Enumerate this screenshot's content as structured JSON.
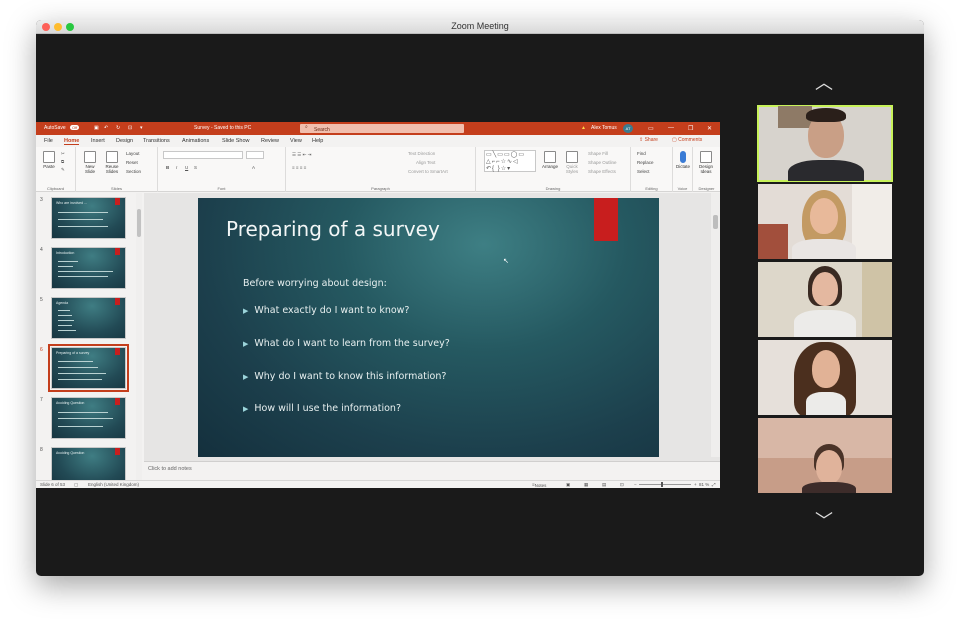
{
  "window": {
    "title": "Zoom Meeting"
  },
  "ppt": {
    "autosave": "AutoSave",
    "autosave_state": "Off",
    "doc_status": "Survey - Saved to this PC",
    "search_placeholder": "Search",
    "user_name": "Alex Tomus",
    "user_initials": "AT",
    "tabs": [
      "File",
      "Home",
      "Insert",
      "Design",
      "Transitions",
      "Animations",
      "Slide Show",
      "Review",
      "View",
      "Help"
    ],
    "share": "Share",
    "comments": "Comments",
    "ribbon": {
      "paste": "Paste",
      "clipboard": "Clipboard",
      "new_slide": "New Slide",
      "reuse_slides": "Reuse Slides",
      "layout": "Layout",
      "reset": "Reset",
      "section": "Section",
      "slides": "Slides",
      "font": "Font",
      "text_direction": "Text Direction",
      "align_text": "Align Text",
      "convert_smartart": "Convert to SmartArt",
      "paragraph": "Paragraph",
      "arrange": "Arrange",
      "quick_styles": "Quick Styles",
      "shape_fill": "Shape Fill",
      "shape_outline": "Shape Outline",
      "shape_effects": "Shape Effects",
      "drawing": "Drawing",
      "find": "Find",
      "replace": "Replace",
      "select": "Select",
      "editing": "Editing",
      "dictate": "Dictate",
      "voice": "Voice",
      "design_ideas": "Design Ideas",
      "designer": "Designer"
    },
    "thumbnails": [
      {
        "num": "3",
        "title": "Who are involved ...",
        "lines": 3
      },
      {
        "num": "4",
        "title": "Introduction",
        "lines": 4
      },
      {
        "num": "5",
        "title": "Agenda",
        "lines": 5
      },
      {
        "num": "6",
        "title": "Preparing of a survey",
        "lines": 4,
        "selected": true
      },
      {
        "num": "7",
        "title": "Avoiding Question",
        "lines": 3
      },
      {
        "num": "8",
        "title": "Avoiding Question",
        "lines": 1
      }
    ],
    "slide": {
      "title": "Preparing of a survey",
      "intro": "Before worrying about design:",
      "bullets": [
        "What exactly do I want to know?",
        "What do I want to learn from the survey?",
        "Why do I want to know this information?",
        "How will I use the information?"
      ]
    },
    "notes_placeholder": "Click to add notes",
    "status": {
      "slide_count": "Slide 6 of 53",
      "language": "English (United Kingdom)",
      "notes": "Notes",
      "zoom": "81 %"
    }
  },
  "colors": {
    "ppt_accent": "#c43e1c",
    "active_speaker": "#c8f25a",
    "slide_bg": "#1c3f4c"
  },
  "icons": [
    "chevron-up-icon",
    "chevron-down-icon",
    "search-icon",
    "warning-icon",
    "cursor-icon"
  ]
}
